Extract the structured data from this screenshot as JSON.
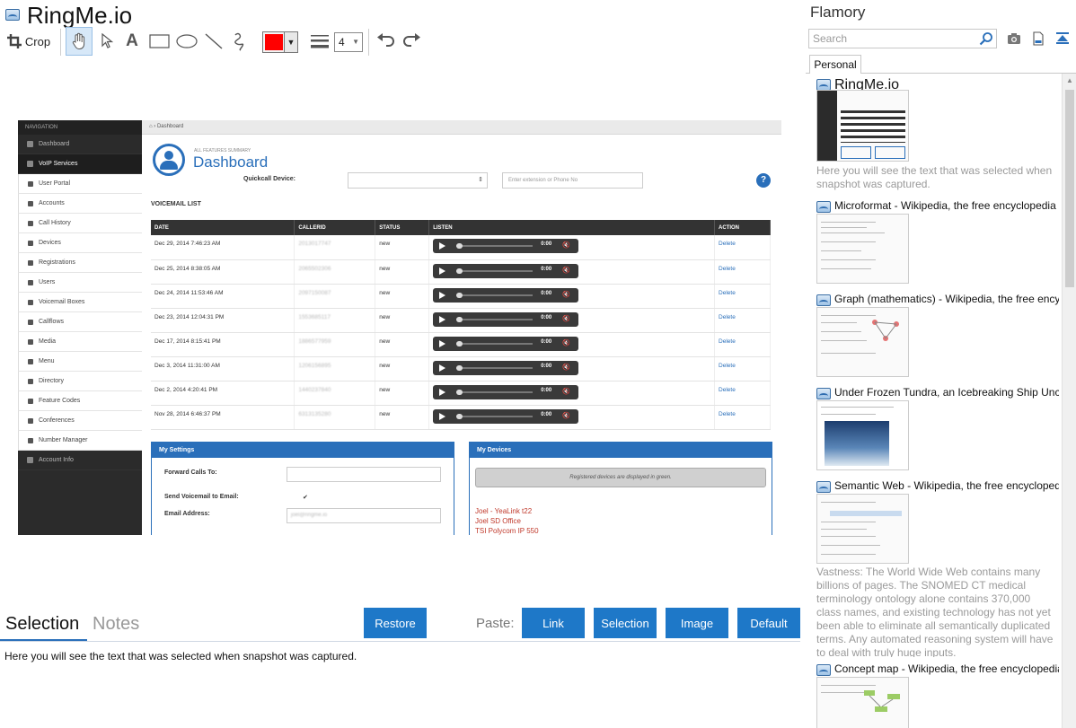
{
  "app": {
    "title": "RingMe.io"
  },
  "toolbar": {
    "crop_label": "Crop",
    "stroke_color": "#ff0000",
    "line_width": "4"
  },
  "snapshot": {
    "nav_header": "NAVIGATION",
    "nav_items": [
      {
        "label": "Dashboard",
        "type": "top"
      },
      {
        "label": "VoIP Services",
        "type": "active"
      },
      {
        "label": "User Portal",
        "type": "sub"
      },
      {
        "label": "Accounts",
        "type": "sub"
      },
      {
        "label": "Call History",
        "type": "sub"
      },
      {
        "label": "Devices",
        "type": "sub"
      },
      {
        "label": "Registrations",
        "type": "sub"
      },
      {
        "label": "Users",
        "type": "sub"
      },
      {
        "label": "Voicemail Boxes",
        "type": "sub"
      },
      {
        "label": "Callflows",
        "type": "sub"
      },
      {
        "label": "Media",
        "type": "sub"
      },
      {
        "label": "Menu",
        "type": "sub"
      },
      {
        "label": "Directory",
        "type": "sub"
      },
      {
        "label": "Feature Codes",
        "type": "sub"
      },
      {
        "label": "Conferences",
        "type": "sub"
      },
      {
        "label": "Number Manager",
        "type": "sub"
      },
      {
        "label": "Account Info",
        "type": "top"
      }
    ],
    "breadcrumb": "Dashboard",
    "summary_label": "ALL FEATURES SUMMARY",
    "page_title": "Dashboard",
    "quickcall_label": "Quickcall Device:",
    "quickcall_select": "⇕",
    "quickcall_placeholder": "Enter extension or Phone No",
    "help_label": "?",
    "voicemail_title": "VOICEMAIL LIST",
    "columns": [
      "DATE",
      "CALLERID",
      "STATUS",
      "LISTEN",
      "ACTION"
    ],
    "rows": [
      {
        "date": "Dec 29, 2014 7:46:23 AM",
        "callerid": "2013017747",
        "status": "new",
        "time": "0:00",
        "action": "Delete"
      },
      {
        "date": "Dec 25, 2014 8:38:05 AM",
        "callerid": "2065502306",
        "status": "new",
        "time": "0:00",
        "action": "Delete"
      },
      {
        "date": "Dec 24, 2014 11:53:46 AM",
        "callerid": "2097150087",
        "status": "new",
        "time": "0:00",
        "action": "Delete"
      },
      {
        "date": "Dec 23, 2014 12:04:31 PM",
        "callerid": "1553685117",
        "status": "new",
        "time": "0:00",
        "action": "Delete"
      },
      {
        "date": "Dec 17, 2014 8:15:41 PM",
        "callerid": "1886577959",
        "status": "new",
        "time": "0:00",
        "action": "Delete"
      },
      {
        "date": "Dec 3, 2014 11:31:00 AM",
        "callerid": "1206156895",
        "status": "new",
        "time": "0:00",
        "action": "Delete"
      },
      {
        "date": "Dec 2, 2014 4:20:41 PM",
        "callerid": "1440237840",
        "status": "new",
        "time": "0:00",
        "action": "Delete"
      },
      {
        "date": "Nov 28, 2014 6:46:37 PM",
        "callerid": "6313135280",
        "status": "new",
        "time": "0:00",
        "action": "Delete"
      }
    ],
    "settings": {
      "title": "My Settings",
      "forward_label": "Forward Calls To:",
      "voicemail_email_label": "Send Voicemail to Email:",
      "email_label": "Address:",
      "email_label_full": "Email Address:",
      "email_value": "joel@ringme.io",
      "check_mark": "✔"
    },
    "devices": {
      "title": "My Devices",
      "bar_text": "Registered devices are displayed in green.",
      "items": [
        "Joel - YeaLink t22",
        "Joel SD Office",
        "TSI Polycom IP 550"
      ]
    }
  },
  "bottom": {
    "tab_selection": "Selection",
    "tab_notes": "Notes",
    "restore_button": "Restore",
    "paste_label": "Paste:",
    "paste_buttons": [
      "Link",
      "Selection",
      "Image",
      "Default"
    ],
    "selected_text": "Here you will see the text that was selected when snapshot was captured."
  },
  "sidebar": {
    "title": "Flamory",
    "search_placeholder": "Search",
    "tab": "Personal",
    "items": [
      {
        "title": "RingMe.io",
        "desc": "Here you will see the text that was selected when snapshot was captured."
      },
      {
        "title": "Microformat - Wikipedia, the free encyclopedia",
        "desc": ""
      },
      {
        "title": "Graph (mathematics) - Wikipedia, the free encyclopedia",
        "desc": ""
      },
      {
        "title": "Under Frozen Tundra, an Icebreaking Ship Uncovers...",
        "desc": ""
      },
      {
        "title": "Semantic Web - Wikipedia, the free encyclopedia",
        "desc": "Vastness: The World Wide Web contains many billions of pages. The SNOMED CT medical terminology ontology alone contains 370,000 class names, and existing technology has not yet been able to eliminate all semantically duplicated terms. Any automated reasoning system will have to deal with truly huge inputs."
      },
      {
        "title": "Concept map - Wikipedia, the free encyclopedia",
        "desc": ""
      }
    ]
  }
}
